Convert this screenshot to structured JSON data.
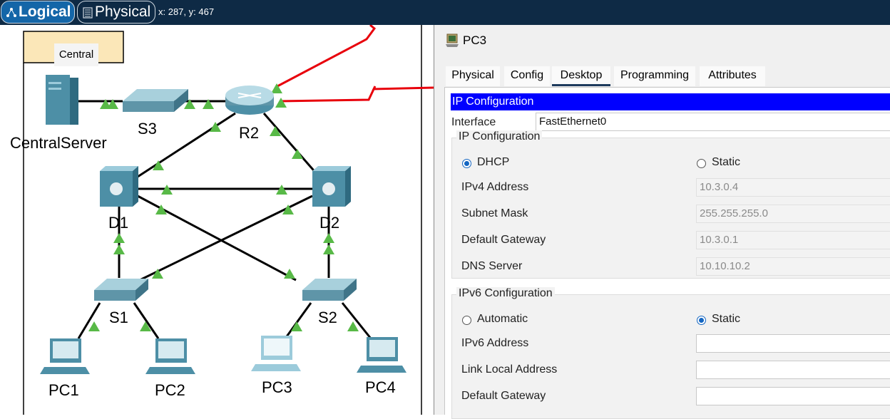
{
  "toolbar": {
    "logical_label": "Logical",
    "physical_label": "Physical",
    "coords": "x: 287, y: 467"
  },
  "topology": {
    "cluster": "Central",
    "devices": {
      "server": "CentralServer",
      "s3": "S3",
      "r2": "R2",
      "d1": "D1",
      "d2": "D2",
      "s1": "S1",
      "s2": "S2",
      "pc1": "PC1",
      "pc2": "PC2",
      "pc3": "PC3",
      "pc4": "PC4"
    },
    "colors": {
      "link": "#000000",
      "serial": "#e8000b",
      "link_up": "#58b947"
    }
  },
  "panel": {
    "title": "PC3",
    "tabs": [
      "Physical",
      "Config",
      "Desktop",
      "Programming",
      "Attributes"
    ],
    "active_tab": "Desktop",
    "ip_config": {
      "header": "IP Configuration",
      "interface_label": "Interface",
      "interface_value": "FastEthernet0",
      "ipv4_group": "IP Configuration",
      "dhcp_label": "DHCP",
      "static_label": "Static",
      "ipv4_mode": "DHCP",
      "ipv4_label": "IPv4 Address",
      "ipv4_value": "10.3.0.4",
      "mask_label": "Subnet Mask",
      "mask_value": "255.255.255.0",
      "gw_label": "Default Gateway",
      "gw_value": "10.3.0.1",
      "dns_label": "DNS Server",
      "dns_value": "10.10.10.2",
      "ipv6_group": "IPv6 Configuration",
      "auto_label": "Automatic",
      "static6_label": "Static",
      "ipv6_mode": "Static",
      "ipv6_label": "IPv6 Address",
      "ipv6_value": "",
      "link_local_label": "Link Local Address",
      "link_local_value": "",
      "gw6_label": "Default Gateway",
      "gw6_value": ""
    }
  }
}
